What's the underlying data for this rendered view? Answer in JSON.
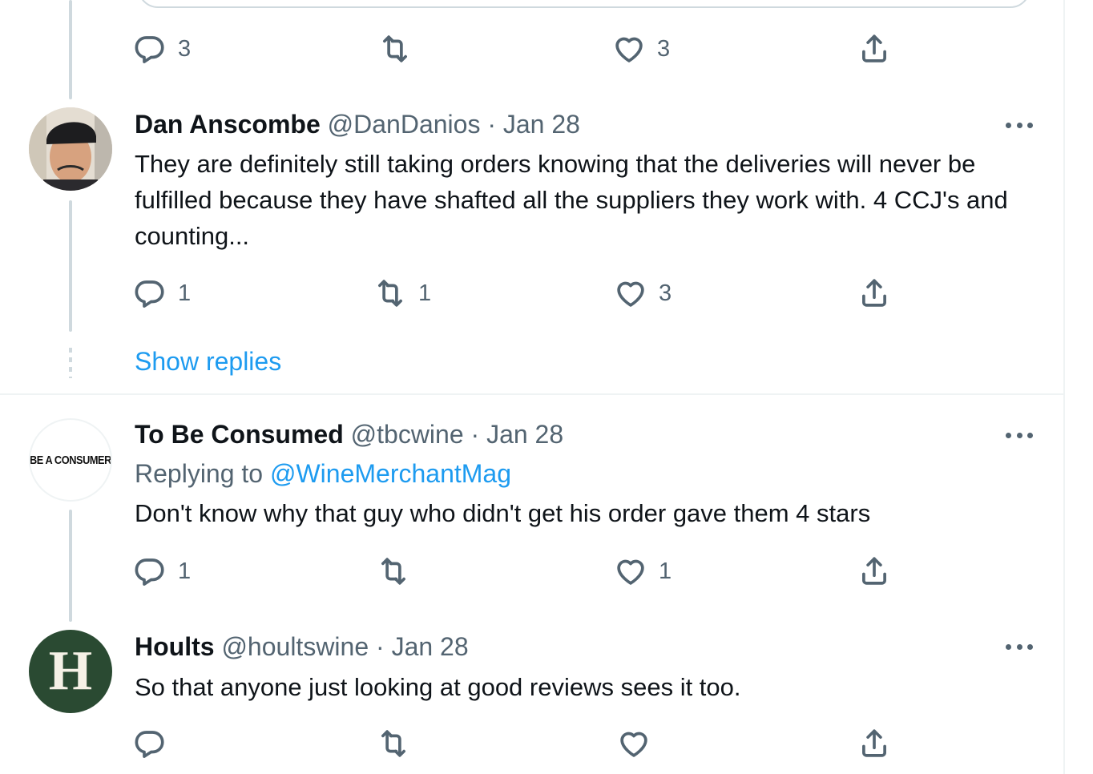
{
  "top_actions": {
    "reply_count": "3",
    "retweet_count": "",
    "like_count": "3"
  },
  "tweets": [
    {
      "name": "Dan Anscombe",
      "handle": "@DanDanios",
      "separator": "·",
      "date": "Jan 28",
      "text": "They are definitely still taking orders knowing that the deliveries will never be fulfilled because they have shafted all the suppliers they work with. 4 CCJ's and counting...",
      "reply_count": "1",
      "retweet_count": "1",
      "like_count": "3"
    },
    {
      "name": "To Be Consumed",
      "handle": "@tbcwine",
      "separator": "·",
      "date": "Jan 28",
      "avatar_text": "BE A CONSUMER",
      "replying_prefix": "Replying to",
      "replying_mention": "@WineMerchantMag",
      "text": "Don't know why that guy who didn't get his order gave them 4 stars",
      "reply_count": "1",
      "retweet_count": "",
      "like_count": "1"
    },
    {
      "name": "Hoults",
      "handle": "@houltswine",
      "separator": "·",
      "date": "Jan 28",
      "avatar_text": "H",
      "text": "So that anyone just looking at good reviews sees it too.",
      "reply_count": "",
      "retweet_count": "",
      "like_count": ""
    }
  ],
  "show_replies_label": "Show replies",
  "icons": {
    "reply": "reply-icon",
    "retweet": "retweet-icon",
    "like": "heart-icon",
    "share": "share-icon",
    "more": "more-icon"
  },
  "colors": {
    "link": "#1d9bf0",
    "muted": "#536471",
    "text": "#0f1419",
    "hoults_avatar": "#2a4a32"
  }
}
